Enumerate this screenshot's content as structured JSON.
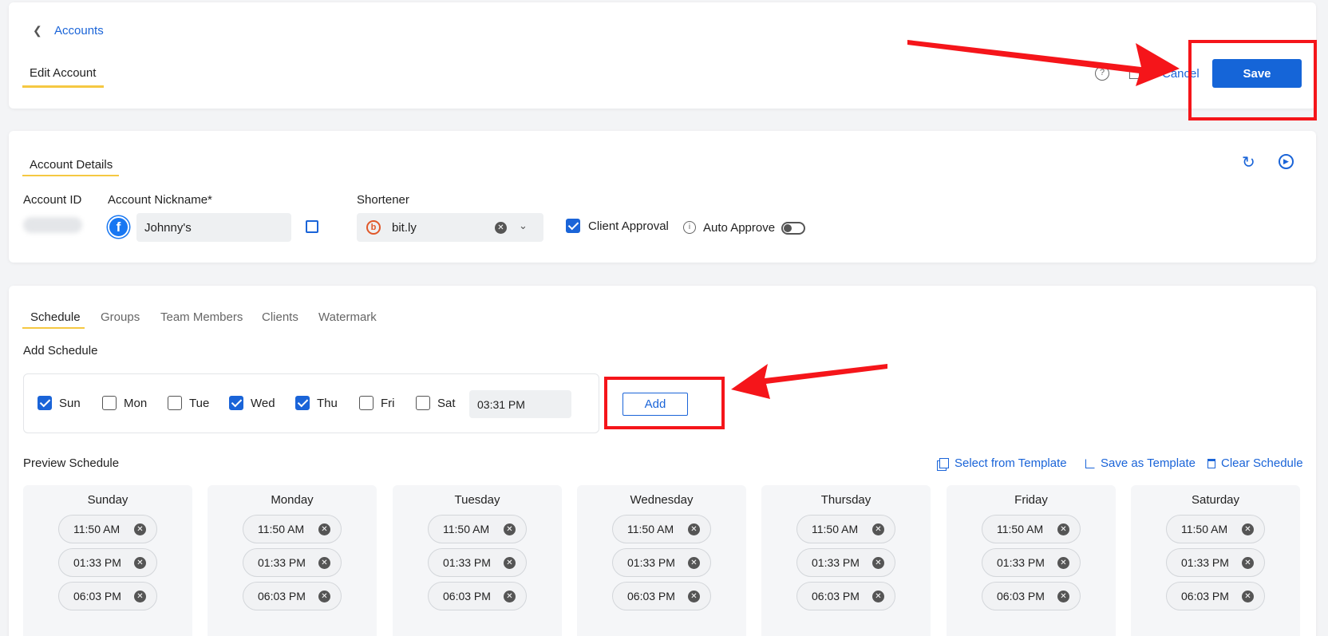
{
  "breadcrumb": {
    "back_label": "Accounts"
  },
  "header": {
    "page_tab": "Edit Account",
    "cancel_label": "Cancel",
    "save_label": "Save"
  },
  "account_details": {
    "section_title": "Account Details",
    "account_id_label": "Account ID",
    "nickname_label": "Account Nickname*",
    "nickname_value": "Johnny's",
    "shortener_label": "Shortener",
    "shortener_value": "bit.ly",
    "client_approval_label": "Client Approval",
    "client_approval_checked": true,
    "auto_approve_label": "Auto Approve",
    "auto_approve_on": false
  },
  "tabs": [
    "Schedule",
    "Groups",
    "Team Members",
    "Clients",
    "Watermark"
  ],
  "add_schedule": {
    "title": "Add Schedule",
    "days": [
      {
        "label": "Sun",
        "checked": true
      },
      {
        "label": "Mon",
        "checked": false
      },
      {
        "label": "Tue",
        "checked": false
      },
      {
        "label": "Wed",
        "checked": true
      },
      {
        "label": "Thu",
        "checked": true
      },
      {
        "label": "Fri",
        "checked": false
      },
      {
        "label": "Sat",
        "checked": false
      }
    ],
    "time_value": "03:31 PM",
    "add_label": "Add"
  },
  "preview": {
    "title": "Preview Schedule",
    "select_template_label": "Select from Template",
    "save_template_label": "Save as Template",
    "clear_label": "Clear Schedule",
    "columns": [
      {
        "day": "Sunday",
        "times": [
          "11:50 AM",
          "01:33 PM",
          "06:03 PM"
        ]
      },
      {
        "day": "Monday",
        "times": [
          "11:50 AM",
          "01:33 PM",
          "06:03 PM"
        ]
      },
      {
        "day": "Tuesday",
        "times": [
          "11:50 AM",
          "01:33 PM",
          "06:03 PM"
        ]
      },
      {
        "day": "Wednesday",
        "times": [
          "11:50 AM",
          "01:33 PM",
          "06:03 PM"
        ]
      },
      {
        "day": "Thursday",
        "times": [
          "11:50 AM",
          "01:33 PM",
          "06:03 PM"
        ]
      },
      {
        "day": "Friday",
        "times": [
          "11:50 AM",
          "01:33 PM",
          "06:03 PM"
        ]
      },
      {
        "day": "Saturday",
        "times": [
          "11:50 AM",
          "01:33 PM",
          "06:03 PM"
        ]
      }
    ]
  },
  "colors": {
    "accent": "#1a64d8",
    "tab_underline": "#f5c842",
    "annotation": "#f5151a"
  }
}
